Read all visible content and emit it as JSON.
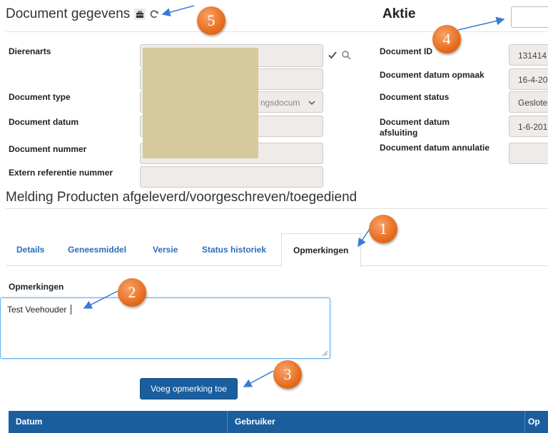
{
  "header": {
    "document_title": "Document gegevens",
    "aktie_title": "Aktie"
  },
  "left_form": {
    "dierenarts_label": "Dierenarts",
    "document_type_label": "Document type",
    "document_type_value_partial": "ngsdocum",
    "document_datum_label": "Document datum",
    "document_nummer_label": "Document nummer",
    "extern_ref_label": "Extern referentie nummer"
  },
  "right_form": {
    "document_id_label": "Document ID",
    "document_id_value": "131414",
    "datum_opmaak_label": "Document datum opmaak",
    "datum_opmaak_value": "16-4-20",
    "status_label": "Document status",
    "status_value": "Geslote",
    "datum_afsluiting_label": "Document datum afsluiting",
    "datum_afsluiting_value": "1-6-201",
    "datum_annulatie_label": "Document datum annulatie"
  },
  "section": {
    "title": "Melding Producten afgeleverd/voorgeschreven/toegediend"
  },
  "tabs": [
    {
      "label": "Details"
    },
    {
      "label": "Geneesmiddel"
    },
    {
      "label": "Versie"
    },
    {
      "label": "Status historiek"
    },
    {
      "label": "Opmerkingen"
    }
  ],
  "remarks": {
    "label": "Opmerkingen",
    "value": "Test Veehouder",
    "add_button": "Voeg opmerking toe"
  },
  "table": {
    "columns": [
      "Datum",
      "Gebruiker",
      "Op"
    ]
  },
  "callouts": [
    "1",
    "2",
    "3",
    "4",
    "5"
  ],
  "colors": {
    "accent": "#1b5e9e",
    "tab_link": "#2a6ebb",
    "callout": "#e86d1e",
    "redaction": "#d5c99c"
  }
}
